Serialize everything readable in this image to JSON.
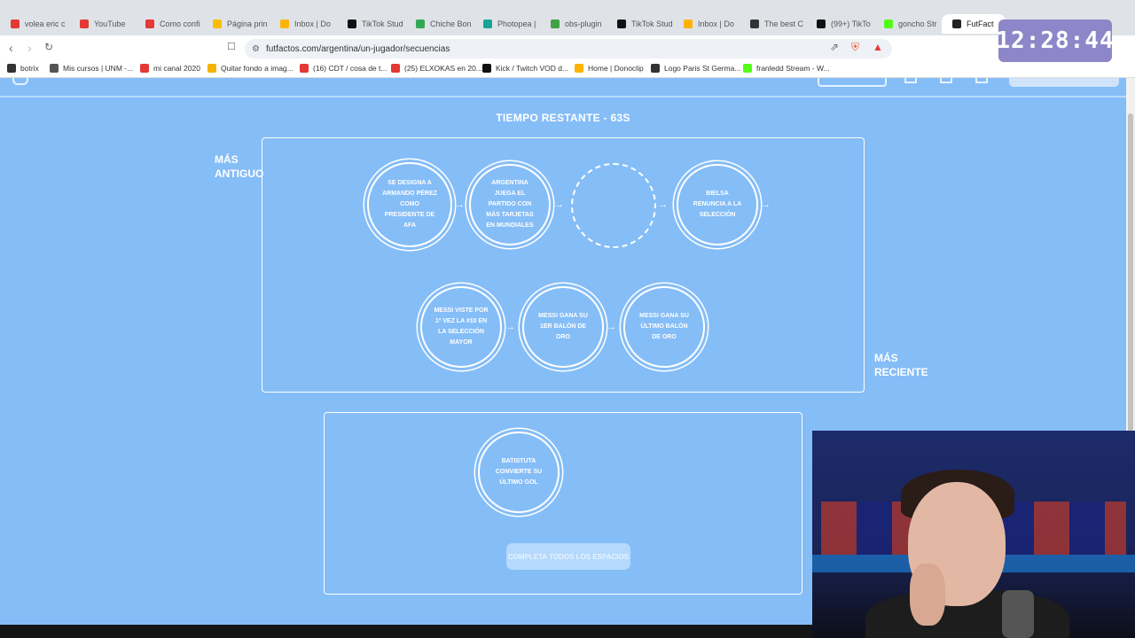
{
  "tabs": [
    {
      "label": "volea eric c",
      "color": "#e53935"
    },
    {
      "label": "YouTube",
      "color": "#e53935"
    },
    {
      "label": "Como confi",
      "color": "#e53935"
    },
    {
      "label": "Página prin",
      "color": "#fbbc04"
    },
    {
      "label": "Inbox | Do",
      "color": "#ffb300"
    },
    {
      "label": "TikTok Stud",
      "color": "#111111"
    },
    {
      "label": "Chiche Bon",
      "color": "#34a853"
    },
    {
      "label": "Photopea |",
      "color": "#18a497"
    },
    {
      "label": "obs-plugin",
      "color": "#43a047"
    },
    {
      "label": "TikTok Stud",
      "color": "#111111"
    },
    {
      "label": "Inbox | Do",
      "color": "#ffb300"
    },
    {
      "label": "The best C",
      "color": "#333333"
    },
    {
      "label": "(99+) TikTo",
      "color": "#111111"
    },
    {
      "label": "goncho Str",
      "color": "#53fc18"
    },
    {
      "label": "FutFact",
      "color": "#222222",
      "active": true
    }
  ],
  "url": "futfactos.com/argentina/un-jugador/secuencias",
  "bookmarks": [
    {
      "label": "botrix",
      "color": "#333"
    },
    {
      "label": "Mis cursos | UNM -...",
      "color": "#555"
    },
    {
      "label": "mi canal 2020",
      "color": "#e53935"
    },
    {
      "label": "Quitar fondo a imag...",
      "color": "#f4b400"
    },
    {
      "label": "(16) CDT / cosa de t...",
      "color": "#e53935"
    },
    {
      "label": "(25) ELXOKAS en 20...",
      "color": "#e53935"
    },
    {
      "label": "Kick / Twitch VOD d...",
      "color": "#111"
    },
    {
      "label": "Home | Donoclip",
      "color": "#ffb300"
    },
    {
      "label": "Logo Paris St Germa...",
      "color": "#333"
    },
    {
      "label": "franledd Stream - W...",
      "color": "#53fc18"
    }
  ],
  "clock": "12:28:44",
  "game": {
    "timer": "TIEMPO RESTANTE - 63S",
    "oldest_label": "MÁS ANTIGUO",
    "newest_label": "MÁS RECIENTE",
    "sequence": [
      "SE DESIGNA A ARMANDO PÉREZ COMO PRESIDENTE DE AFA",
      "ARGENTINA JUEGA EL PARTIDO CON MÁS TARJETAS EN MUNDIALES",
      "",
      "BIELSA RENUNCIA A LA SELECCIÓN",
      "MESSI VISTE POR 1ª VEZ LA #10 EN LA SELECCIÓN MAYOR",
      "MESSI GANA SU 1ER BALÓN DE ORO",
      "MESSI GANA SU ÚLTIMO BALÓN DE ORO"
    ],
    "pending": "BATISTUTA CONVIERTE SU ÚLTIMO GOL",
    "complete_button": "COMPLETA TODOS LOS ESPACIOS"
  }
}
